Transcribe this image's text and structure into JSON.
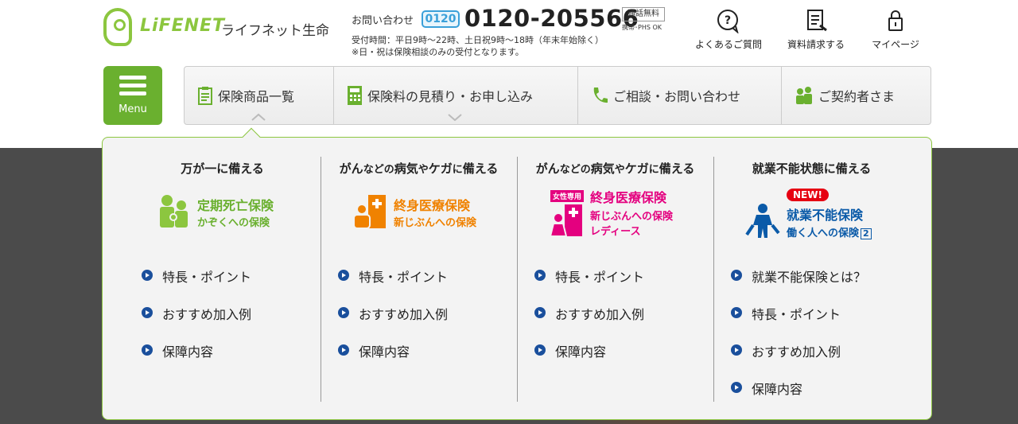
{
  "header": {
    "logo_text": "LiFENET",
    "logo_ja": "ライフネット生命",
    "contact_label": "お問い合わせ",
    "freedial_mark": "0120",
    "phone": "0120-205566",
    "free_badge": "通話無料",
    "free_note": "携帯･PHS OK",
    "hours_line1": "受付時間：平日9時～22時、土日祝9時～18時（年末年始除く）",
    "hours_line2": "※日・祝は保険相談のみの受付となります。",
    "utility": [
      {
        "label": "よくあるご質問",
        "icon": "faq-icon"
      },
      {
        "label": "資料請求する",
        "icon": "document-request-icon"
      },
      {
        "label": "マイページ",
        "icon": "lock-icon"
      }
    ]
  },
  "nav": {
    "menu_label": "Menu",
    "items": [
      {
        "label": "保険商品一覧",
        "icon": "clipboard-icon"
      },
      {
        "label": "保険料の見積り・お申し込み",
        "icon": "calculator-icon"
      },
      {
        "label": "ご相談・お問い合わせ",
        "icon": "phone-icon"
      },
      {
        "label": "ご契約者さま",
        "icon": "people-icon"
      }
    ]
  },
  "mega_menu": {
    "columns": [
      {
        "heading": "万が一に備える",
        "product_name": "定期死亡保険",
        "product_sub": "かぞくへの保険",
        "color": "#8cc63f",
        "links": [
          "特長・ポイント",
          "おすすめ加入例",
          "保障内容"
        ]
      },
      {
        "heading_main": "がん",
        "heading_small1": "などの",
        "heading_mid": "病気",
        "heading_small2": "や",
        "heading_end": "ケガ",
        "heading_small3": "に",
        "heading_tail": "備える",
        "product_name": "終身医療保険",
        "product_sub": "新じぶんへの保険",
        "color": "#f08200",
        "links": [
          "特長・ポイント",
          "おすすめ加入例",
          "保障内容"
        ]
      },
      {
        "heading_main": "がん",
        "heading_small1": "などの",
        "heading_mid": "病気",
        "heading_small2": "や",
        "heading_end": "ケガ",
        "heading_small3": "に",
        "heading_tail": "備える",
        "tag": "女性専用",
        "product_name": "終身医療保険",
        "product_sub": "新じぶんへの保険",
        "product_sub2": "レディース",
        "color": "#e4007f",
        "links": [
          "特長・ポイント",
          "おすすめ加入例",
          "保障内容"
        ]
      },
      {
        "heading": "就業不能状態に備える",
        "badge": "NEW!",
        "product_name": "就業不能保険",
        "product_sub": "働く人への保険",
        "product_sub_num": "2",
        "color": "#0a5aa8",
        "links": [
          "就業不能保険とは？",
          "特長・ポイント",
          "おすすめ加入例",
          "保障内容"
        ]
      }
    ]
  }
}
